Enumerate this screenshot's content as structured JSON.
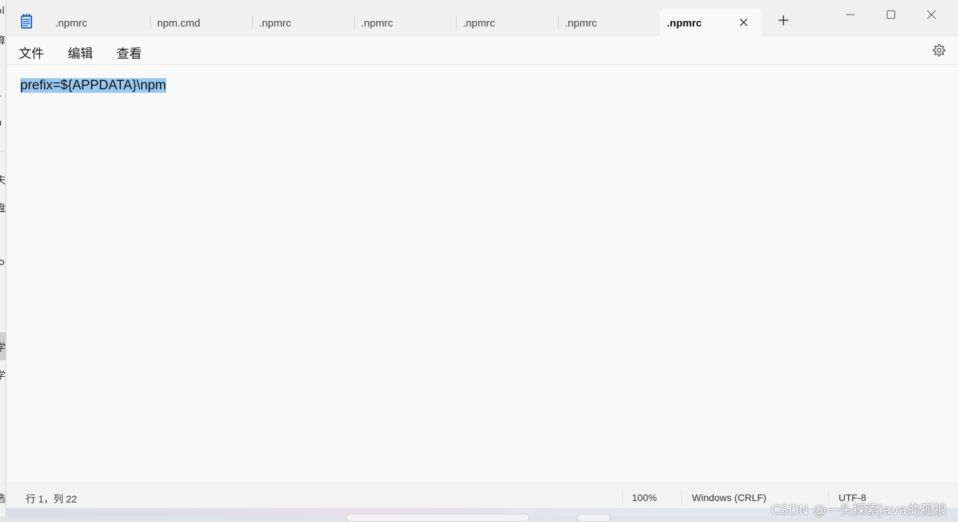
{
  "window": {
    "tabs": [
      {
        "label": ".npmrc",
        "active": false
      },
      {
        "label": "npm.cmd",
        "active": false
      },
      {
        "label": ".npmrc",
        "active": false
      },
      {
        "label": ".npmrc",
        "active": false
      },
      {
        "label": ".npmrc",
        "active": false
      },
      {
        "label": ".npmrc",
        "active": false
      },
      {
        "label": ".npmrc",
        "active": true
      }
    ],
    "icons": {
      "app": "notepad-icon",
      "close_tab": "close-icon",
      "new_tab": "plus-icon",
      "minimize": "minimize-icon",
      "maximize": "maximize-icon",
      "close_window": "close-icon",
      "settings": "gear-icon"
    }
  },
  "menu": {
    "file": "文件",
    "edit": "编辑",
    "view": "查看"
  },
  "editor": {
    "line1": "prefix=${APPDATA}\\npm",
    "selection_color": "#99c9ef"
  },
  "status": {
    "position": "行 1，列 22",
    "zoom": "100%",
    "line_ending": "Windows (CRLF)",
    "encoding": "UTF-8"
  },
  "watermark": "CSDN @一头探索java的孤狼",
  "background_window": {
    "fragments": [
      "ol",
      "算",
      "(",
      "s",
      "a",
      "夫",
      "盘",
      "lo",
      "(",
      "(",
      "学",
      "学",
      "选"
    ]
  }
}
